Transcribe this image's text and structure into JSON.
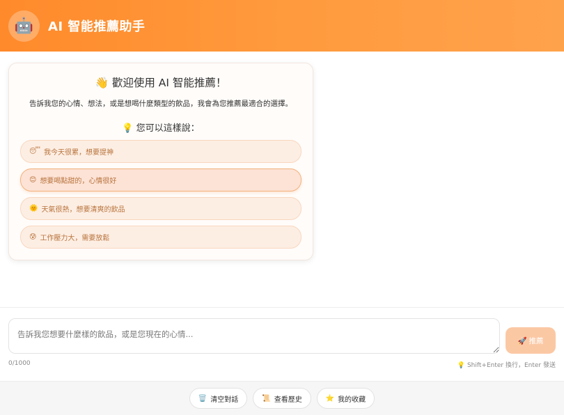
{
  "header": {
    "avatar_icon": "🤖",
    "title": "AI 智能推薦助手"
  },
  "welcome": {
    "title": "👋 歡迎使用 AI 智能推薦！",
    "description": "告訴我您的心情、想法，或是想喝什麼類型的飲品，我會為您推薦最適合的選擇。",
    "hint_title": "💡 您可以這樣說：",
    "suggestions": [
      {
        "emoji": "😴",
        "text": "我今天很累，想要提神"
      },
      {
        "emoji": "😊",
        "text": "想要喝點甜的，心情很好"
      },
      {
        "emoji": "🌞",
        "text": "天氣很熱，想要清爽的飲品"
      },
      {
        "emoji": "😰",
        "text": "工作壓力大，需要放鬆"
      }
    ]
  },
  "input": {
    "placeholder": "告訴我您想要什麼樣的飲品，或是您現在的心情...",
    "value": "",
    "char_count": "0/1000",
    "tip": "💡 Shift+Enter 換行，Enter 發送",
    "send_label": "🚀 推薦"
  },
  "footer": {
    "clear": {
      "icon": "🗑️",
      "label": "清空對話"
    },
    "history": {
      "icon": "📜",
      "label": "查看歷史"
    },
    "favorites": {
      "icon": "⭐",
      "label": "我的收藏"
    }
  },
  "colors": {
    "accent": "#ff8a2b",
    "suggestion_bg": "#fdeee3",
    "send_disabled": "#fbc8a4"
  }
}
